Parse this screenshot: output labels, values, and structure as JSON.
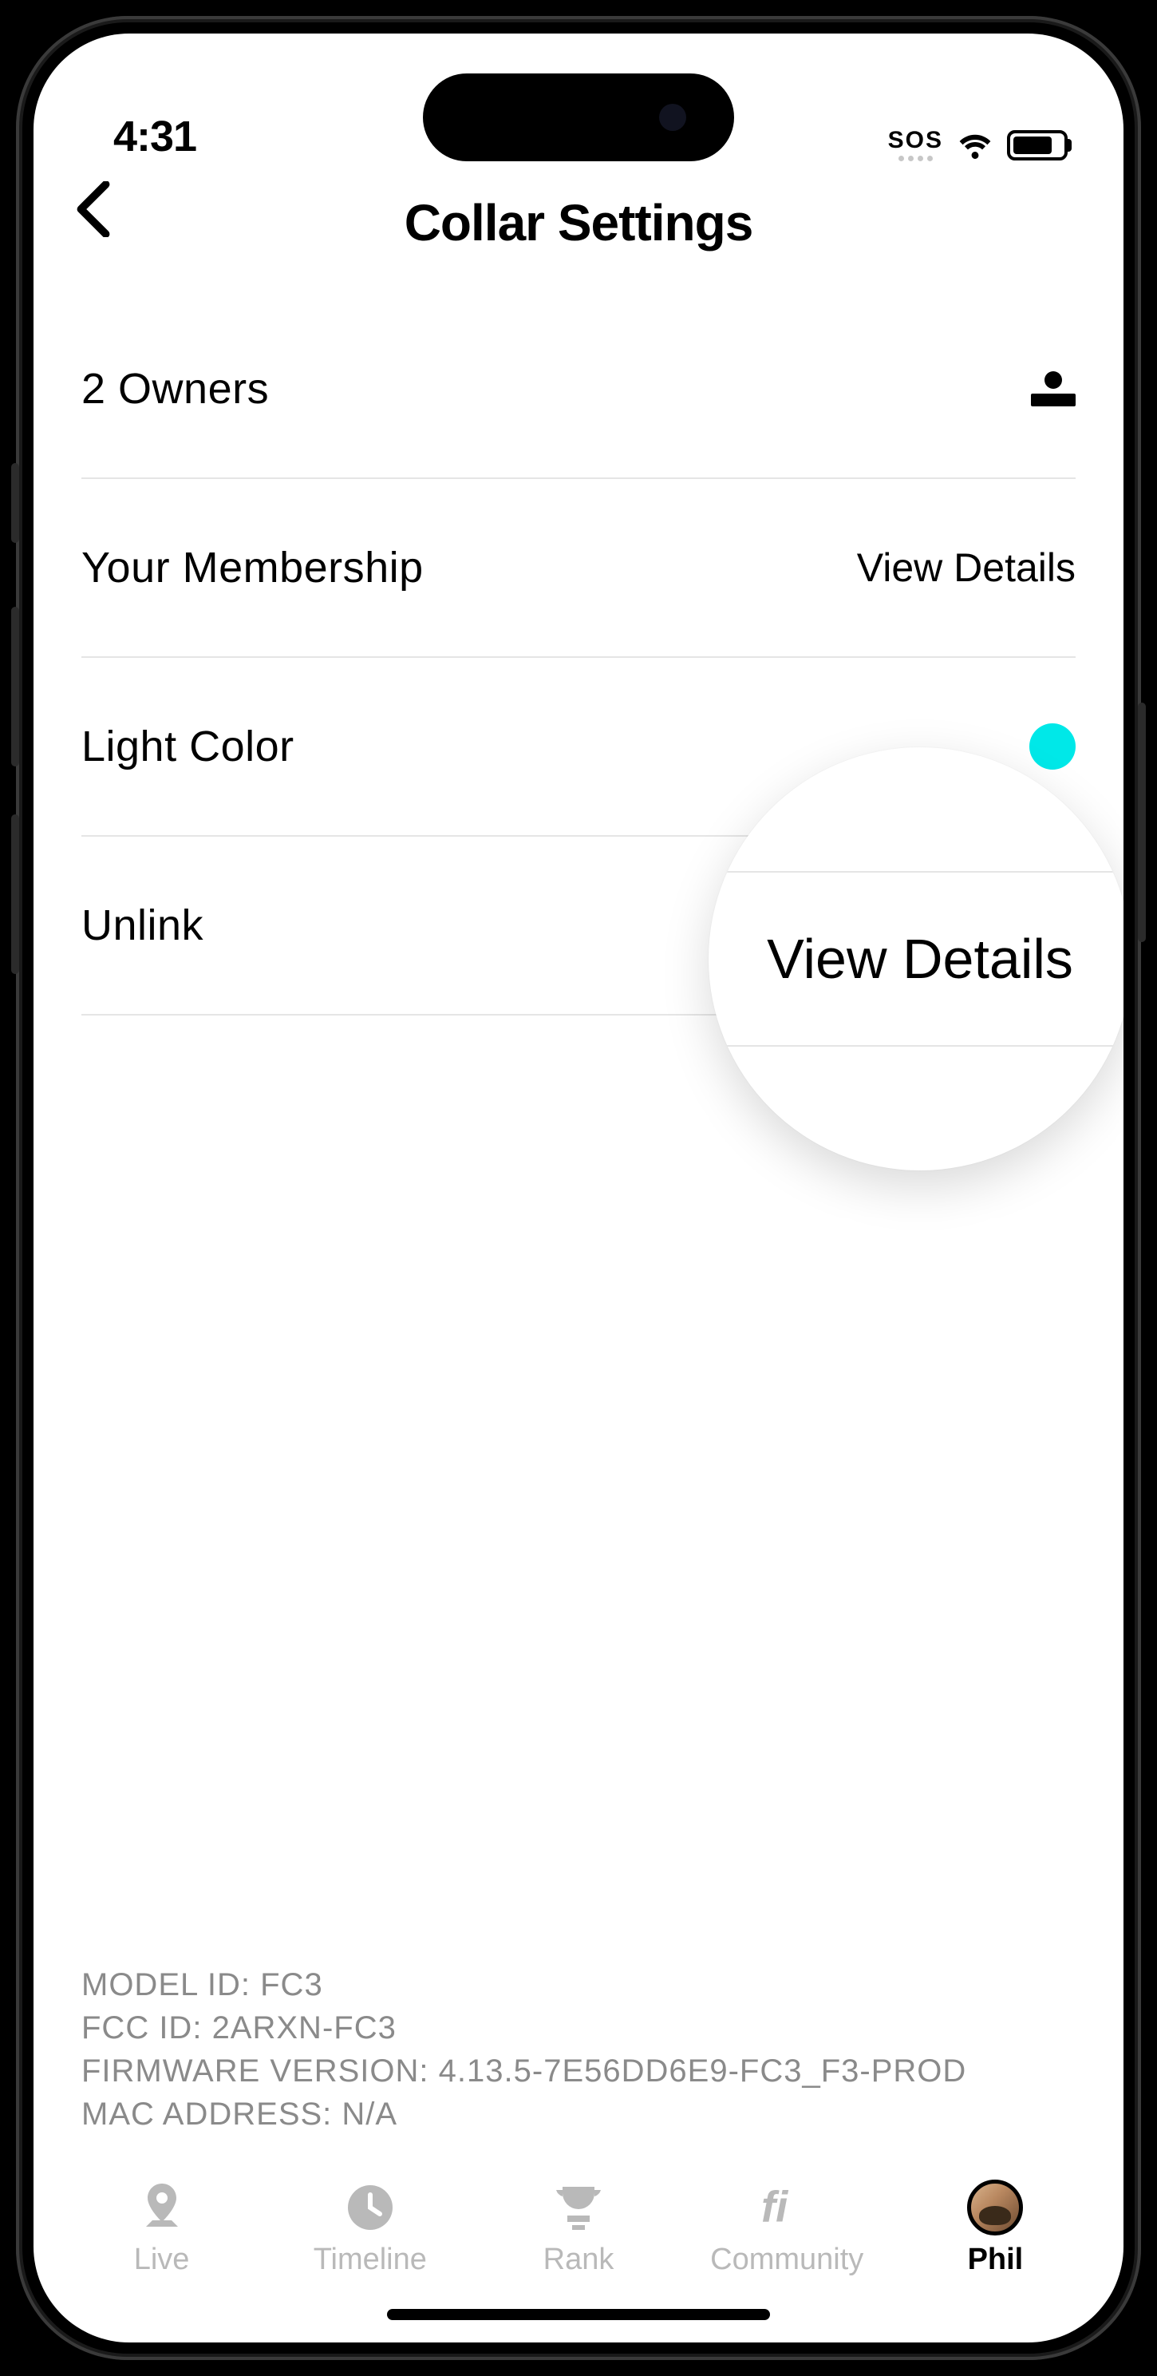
{
  "status_bar": {
    "time": "4:31",
    "sos": "SOS"
  },
  "header": {
    "title": "Collar Settings"
  },
  "rows": {
    "owners": {
      "label": "2 Owners"
    },
    "membership": {
      "label": "Your Membership",
      "value": "View Details"
    },
    "light_color": {
      "label": "Light Color",
      "color": "#00e8e8"
    },
    "unlink": {
      "label": "Unlink"
    }
  },
  "magnifier": {
    "text": "View Details"
  },
  "device_info": {
    "model_id_label": "MODEL ID:",
    "model_id_value": "FC3",
    "fcc_id_label": "FCC ID:",
    "fcc_id_value": "2ARXN-FC3",
    "firmware_label": "FIRMWARE VERSION:",
    "firmware_value": "4.13.5-7E56DD6E9-FC3_F3-PROD",
    "mac_label": "MAC ADDRESS:",
    "mac_value": "N/A"
  },
  "tabs": {
    "live": "Live",
    "timeline": "Timeline",
    "rank": "Rank",
    "community": "Community",
    "phil": "Phil"
  }
}
